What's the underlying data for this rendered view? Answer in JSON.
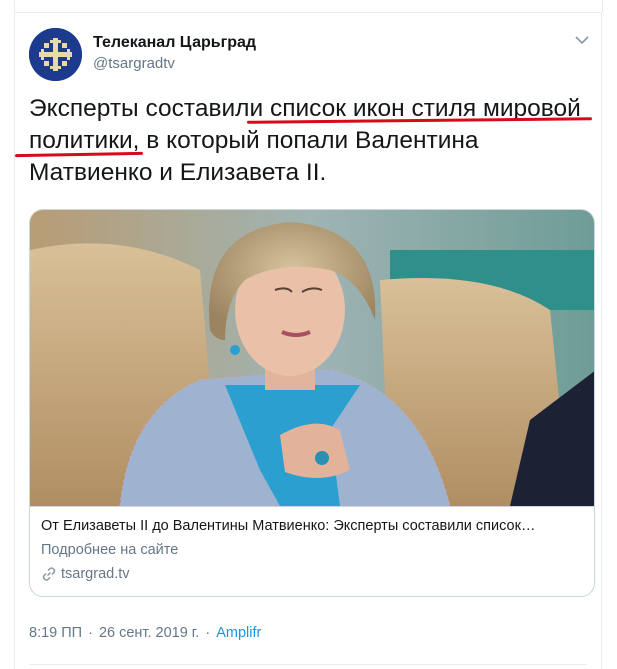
{
  "account": {
    "name": "Телеканал Царьград",
    "handle": "@tsargradtv"
  },
  "tweet": {
    "line1_before": "Эксперты составили ",
    "line1_highlight": "список икон стиля мировой",
    "line2_highlight": "политики,",
    "line2_after": " в который попали Валентина",
    "line3": "Матвиенко и Елизавета II."
  },
  "card": {
    "title": "От Елизаветы II до Валентины Матвиенко: Эксперты составили список…",
    "description": "Подробнее на сайте",
    "domain": "tsargrad.tv"
  },
  "meta": {
    "time": "8:19 ПП",
    "date": "26 сент. 2019 г.",
    "app": "Amplifr"
  },
  "colors": {
    "underline": "#d60b1a",
    "link": "#1b95e0",
    "avatar_bg": "#1c3a8e"
  }
}
